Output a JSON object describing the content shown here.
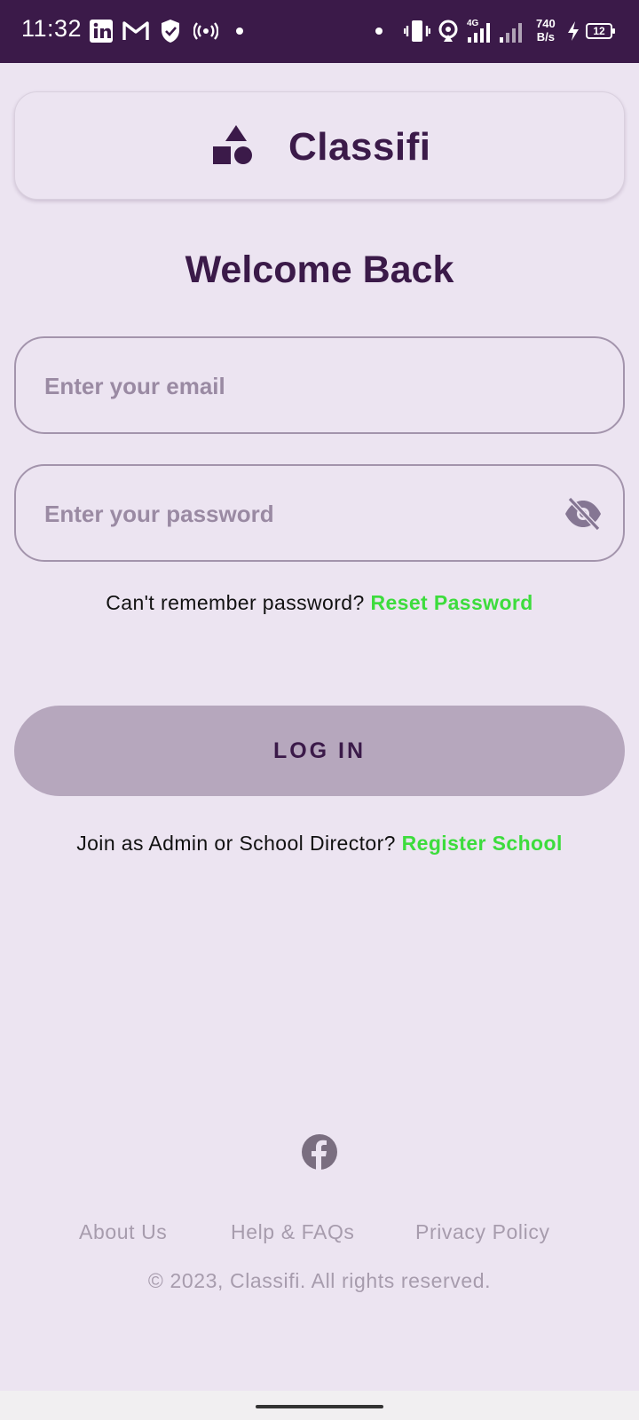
{
  "status_bar": {
    "time": "11:32",
    "net_speed_value": "740",
    "net_speed_unit": "B/s",
    "battery_level": "12",
    "icons": [
      "linkedin-icon",
      "gmail-icon",
      "shield-icon",
      "hotspot-icon",
      "dot-icon",
      "dot-icon",
      "vibrate-icon",
      "wifi-hotspot-icon",
      "signal-4g-icon",
      "signal-icon",
      "charging-icon",
      "battery-icon"
    ]
  },
  "header": {
    "brand": "Classifi"
  },
  "login": {
    "title": "Welcome Back",
    "email_placeholder": "Enter your email",
    "password_placeholder": "Enter your password",
    "reset_prompt": "Can't remember password?",
    "reset_link": "Reset Password",
    "login_button": "LOG IN",
    "register_prompt": "Join as Admin or School Director?",
    "register_link": "Register School"
  },
  "footer": {
    "links": [
      "About Us",
      "Help & FAQs",
      "Privacy Policy"
    ],
    "copyright": "2023, Classifi. All rights reserved."
  },
  "colors": {
    "primary": "#3b1a49",
    "background": "#ece4f1",
    "link": "#3ddc3d",
    "button": "#b6a7bd"
  }
}
